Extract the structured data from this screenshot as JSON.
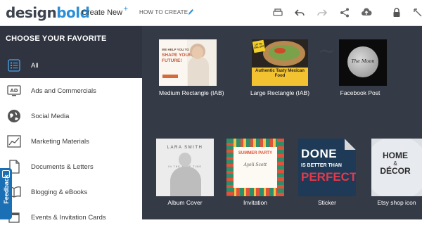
{
  "app": {
    "logo_part1": "design",
    "logo_part2": "bold"
  },
  "topbar": {
    "create_new": "Create New",
    "create_plus": "+",
    "how_to_create": "HOW TO CREATE",
    "icons": [
      "print-icon",
      "undo-icon",
      "redo-icon",
      "share-icon",
      "upload-icon",
      "lock-icon",
      "expand-icon"
    ]
  },
  "sidebar": {
    "header": "CHOOSE YOUR FAVORITE",
    "items": [
      {
        "label": "All",
        "icon": "list-icon",
        "active": true
      },
      {
        "label": "Ads and Commercials",
        "icon": "ad-icon",
        "active": false
      },
      {
        "label": "Social Media",
        "icon": "globe-icon",
        "active": false
      },
      {
        "label": "Marketing Materials",
        "icon": "chart-icon",
        "active": false
      },
      {
        "label": "Documents & Letters",
        "icon": "document-icon",
        "active": false
      },
      {
        "label": "Blogging & eBooks",
        "icon": "book-icon",
        "active": false
      },
      {
        "label": "Events & Invitation Cards",
        "icon": "calendar-icon",
        "active": false
      }
    ],
    "feedback": "Feedback"
  },
  "gallery": {
    "templates": [
      {
        "caption": "Medium Rectangle (IAB)",
        "thumb_text": [
          "WE HELP YOU TO",
          "SHAPE YOUR",
          "FUTURE!"
        ]
      },
      {
        "caption": "Large Rectangle (IAB)",
        "thumb_text": [
          "Authentic Tasty Mexican Food",
          "UP TO 30% OFF"
        ]
      },
      {
        "caption": "Facebook Post",
        "thumb_text": [
          "The Moon"
        ]
      },
      {
        "caption": "Album Cover",
        "thumb_text": [
          "LARA SMITH",
          "IN THE SAME TIME"
        ]
      },
      {
        "caption": "Invitation",
        "thumb_text": [
          "SUMMER PARTY",
          "Ayeli Scott"
        ]
      },
      {
        "caption": "Sticker",
        "thumb_text": [
          "DONE",
          "IS BETTER THAN",
          "PERFECT"
        ]
      },
      {
        "caption": "Etsy shop icon",
        "thumb_text": [
          "HOME",
          "&",
          "DÉCOR"
        ]
      }
    ]
  }
}
